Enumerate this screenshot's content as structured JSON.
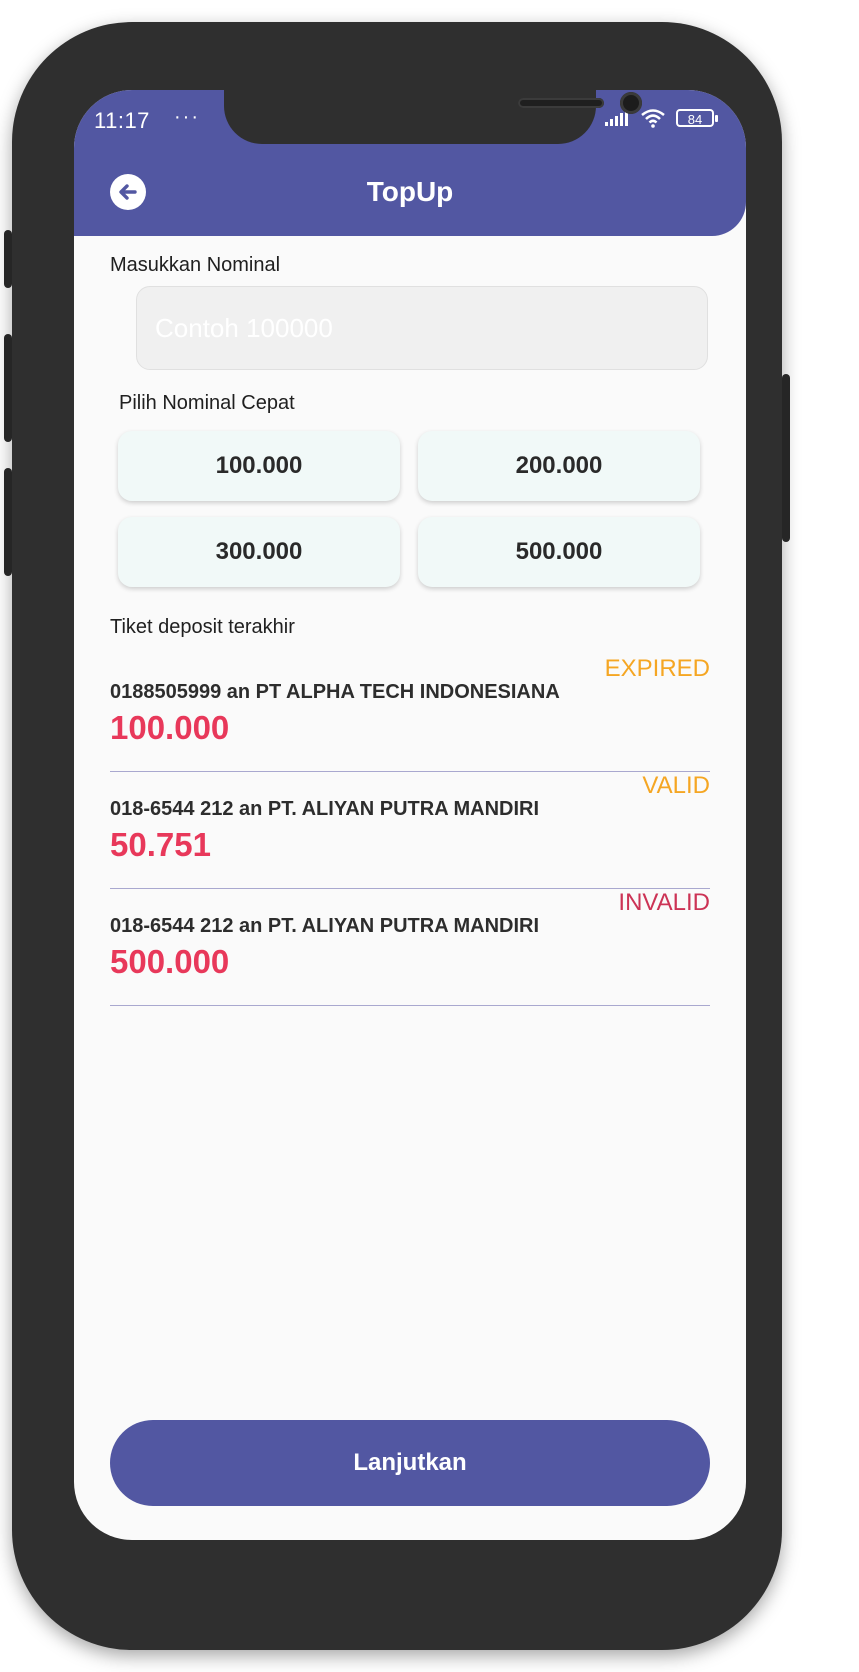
{
  "status_bar": {
    "time": "11:17",
    "dots": "···",
    "battery": "84"
  },
  "header": {
    "title": "TopUp"
  },
  "nominal": {
    "label": "Masukkan Nominal",
    "placeholder": "Contoh 100000",
    "value": ""
  },
  "quick": {
    "label": "Pilih Nominal Cepat",
    "options": [
      "100.000",
      "200.000",
      "300.000",
      "500.000"
    ]
  },
  "tickets": {
    "label": "Tiket deposit terakhir",
    "items": [
      {
        "status": "EXPIRED",
        "status_color": "#f5a623",
        "account": "0188505999 an PT ALPHA TECH INDONESIANA",
        "amount": "100.000"
      },
      {
        "status": "VALID",
        "status_color": "#f5a623",
        "account": "018-6544 212 an PT. ALIYAN PUTRA MANDIRI",
        "amount": "50.751"
      },
      {
        "status": "INVALID",
        "status_color": "#cc3355",
        "account": "018-6544 212 an PT. ALIYAN PUTRA MANDIRI",
        "amount": "500.000"
      }
    ]
  },
  "actions": {
    "continue_label": "Lanjutkan"
  },
  "colors": {
    "primary": "#5257a2",
    "amount": "#e8385a",
    "chip_bg": "#f1f9f8"
  }
}
